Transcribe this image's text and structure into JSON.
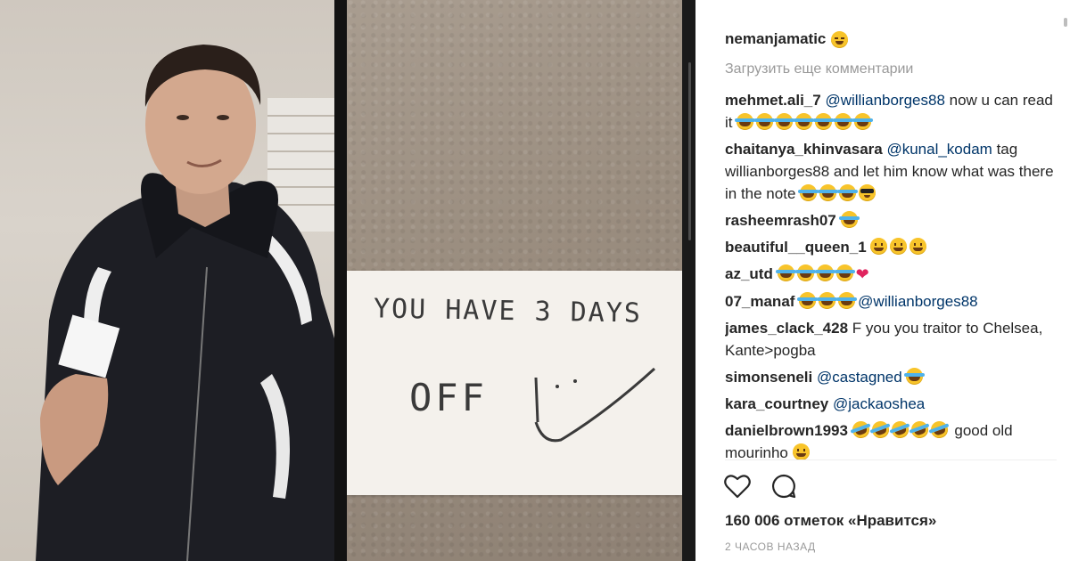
{
  "colors": {
    "accent": "#003569",
    "muted": "#999999",
    "heart": "#e0245e"
  },
  "post": {
    "owner": "nemanjamatic",
    "owner_emoji": "wink-emoji",
    "note": {
      "line1": "YOU HAVE 3 DAYS",
      "line2": "OFF"
    }
  },
  "load_more": "Загрузить еще комментарии",
  "comments": [
    {
      "user": "mehmet.ali_7",
      "mention": "@willianborges88",
      "text": " now u can read it",
      "emojis": [
        "tears",
        "tears",
        "tears",
        "tears",
        "tears",
        "tears",
        "tears"
      ]
    },
    {
      "user": "chaitanya_khinvasara",
      "mention": "@kunal_kodam",
      "text": " tag willianborges88 and let him know what was there in the note",
      "emojis": [
        "tears",
        "tears",
        "tears",
        "cool"
      ]
    },
    {
      "user": "rasheemrash07",
      "mention": "",
      "text": "",
      "emojis": [
        "tears"
      ]
    },
    {
      "user": "beautiful__queen_1",
      "mention": "",
      "text": "",
      "emojis": [
        "smile",
        "smile",
        "smile"
      ]
    },
    {
      "user": "az_utd",
      "mention": "",
      "text": "",
      "emojis": [
        "tears",
        "tears",
        "tears",
        "tears",
        "heart"
      ]
    },
    {
      "user": "07_manaf",
      "mention": "",
      "text": "",
      "emojis": [
        "tears",
        "tears",
        "tears"
      ],
      "trailing_mention": "@willianborges88"
    },
    {
      "user": "james_clack_428",
      "mention": "",
      "text": " F you you traitor to Chelsea, Kante>pogba",
      "emojis": []
    },
    {
      "user": "simonseneli",
      "mention": "@castagned",
      "text": "",
      "emojis": [
        "tears"
      ]
    },
    {
      "user": "kara_courtney",
      "mention": "@jackaoshea",
      "text": "",
      "emojis": []
    },
    {
      "user": "danielbrown1993",
      "mention": "",
      "text": "",
      "emojis": [
        "roll",
        "roll",
        "roll",
        "roll",
        "roll"
      ],
      "trailing_text": " good old mourinho",
      "trailing_emojis": [
        "smile"
      ]
    }
  ],
  "likes": "160 006 отметок «Нравится»",
  "time": "2 ЧАСОВ НАЗАД",
  "icons": {
    "like": "heart-outline-icon",
    "comment": "speech-bubble-icon"
  }
}
